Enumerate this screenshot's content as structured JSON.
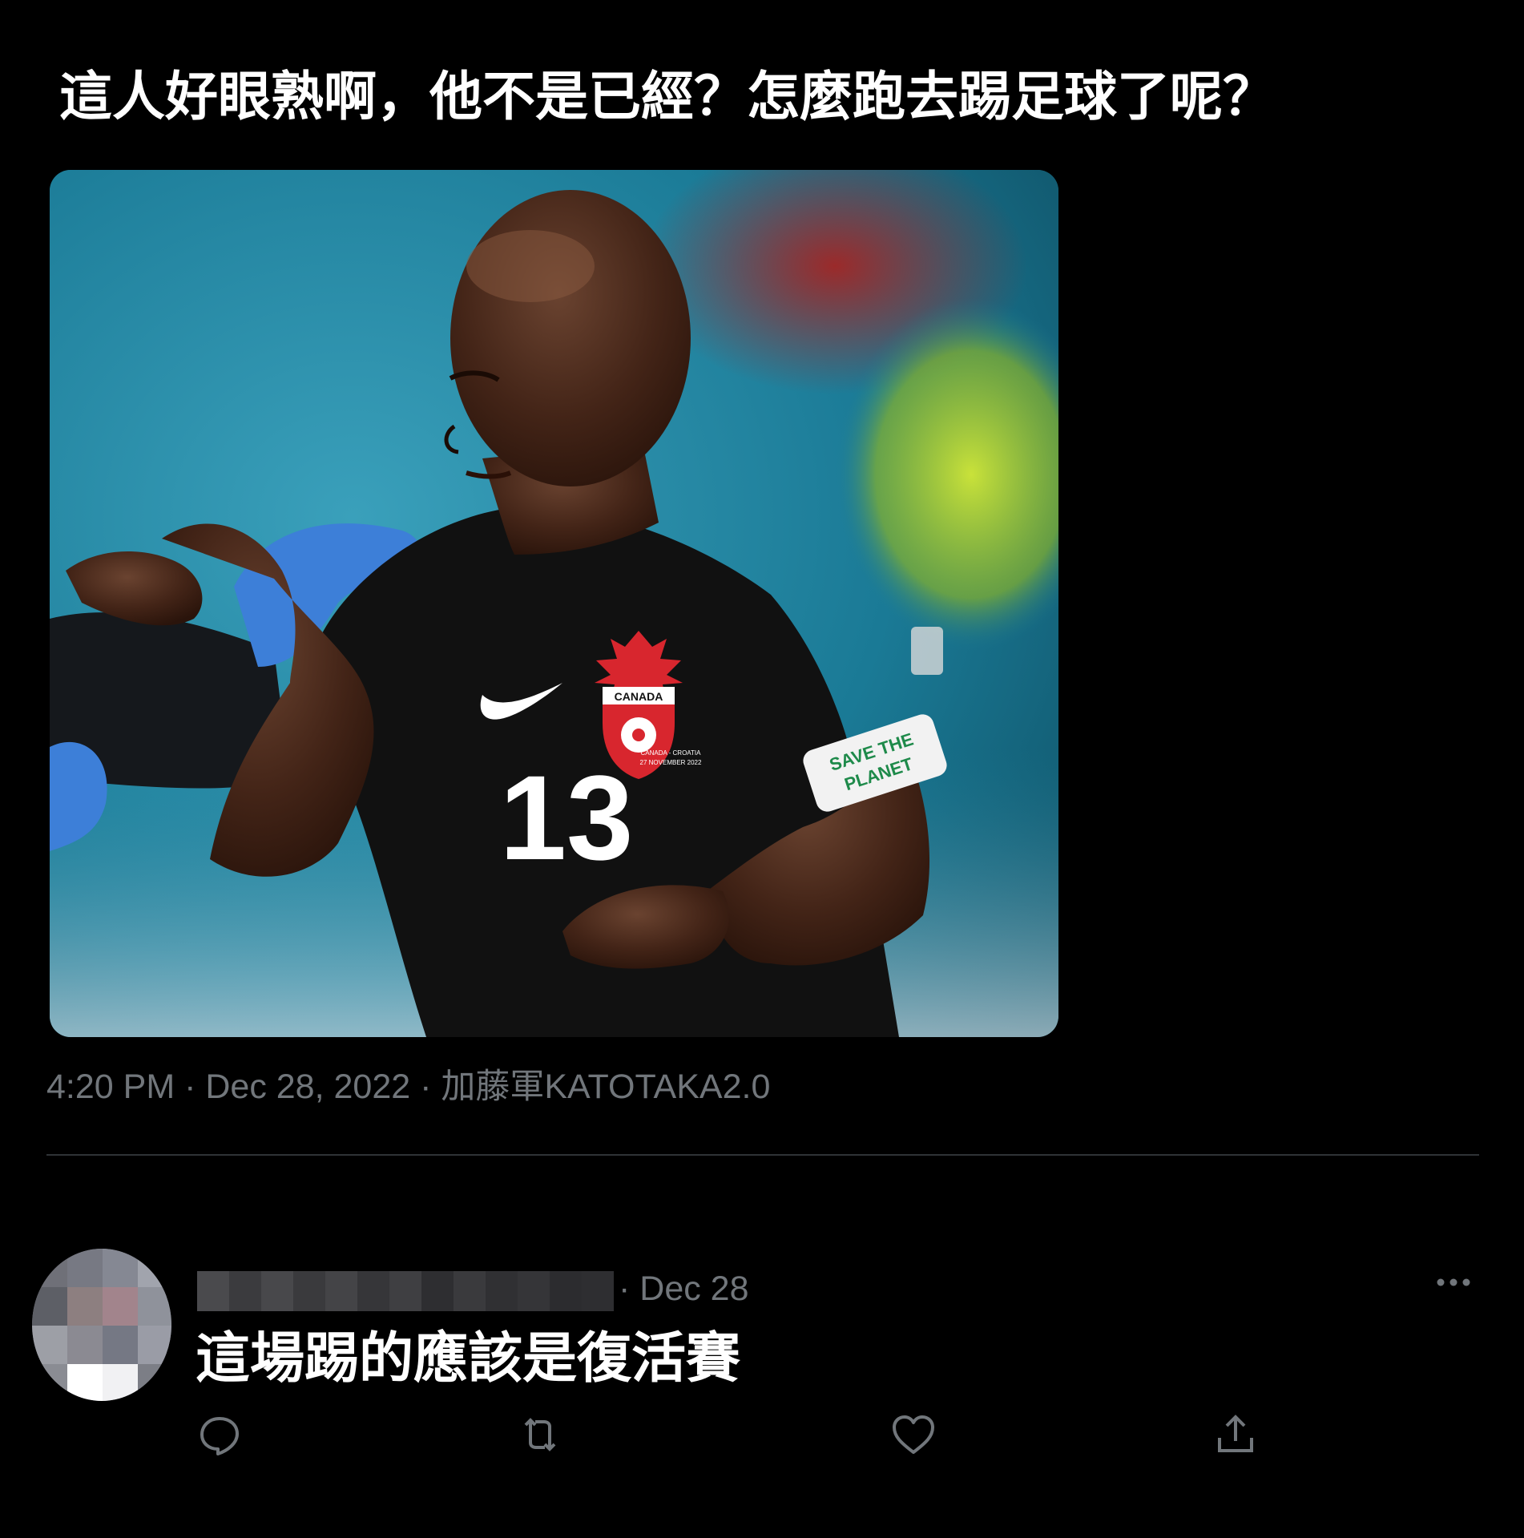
{
  "tweet": {
    "text": "這人好眼熟啊，他不是已經？怎麼跑去踢足球了呢？",
    "meta": "4:20 PM · Dec 28, 2022 · 加藤軍KATOTAKA2.0",
    "media": {
      "jersey_brand_text": "CANADA",
      "jersey_number": "13",
      "match_text_line1": "CANADA - CROATIA",
      "match_text_line2": "27 NOVEMBER 2022",
      "armband_line1": "SAVE THE",
      "armband_line2": "PLANET"
    }
  },
  "reply": {
    "date": "· Dec 28",
    "text": "這場踢的應該是復活賽",
    "icons": {
      "more": "more-icon",
      "reply": "reply-icon",
      "retweet": "retweet-icon",
      "like": "like-icon",
      "share": "share-icon"
    }
  },
  "colors": {
    "background": "#000000",
    "text": "#ffffff",
    "muted": "#71767b",
    "divider": "#2f3336"
  }
}
